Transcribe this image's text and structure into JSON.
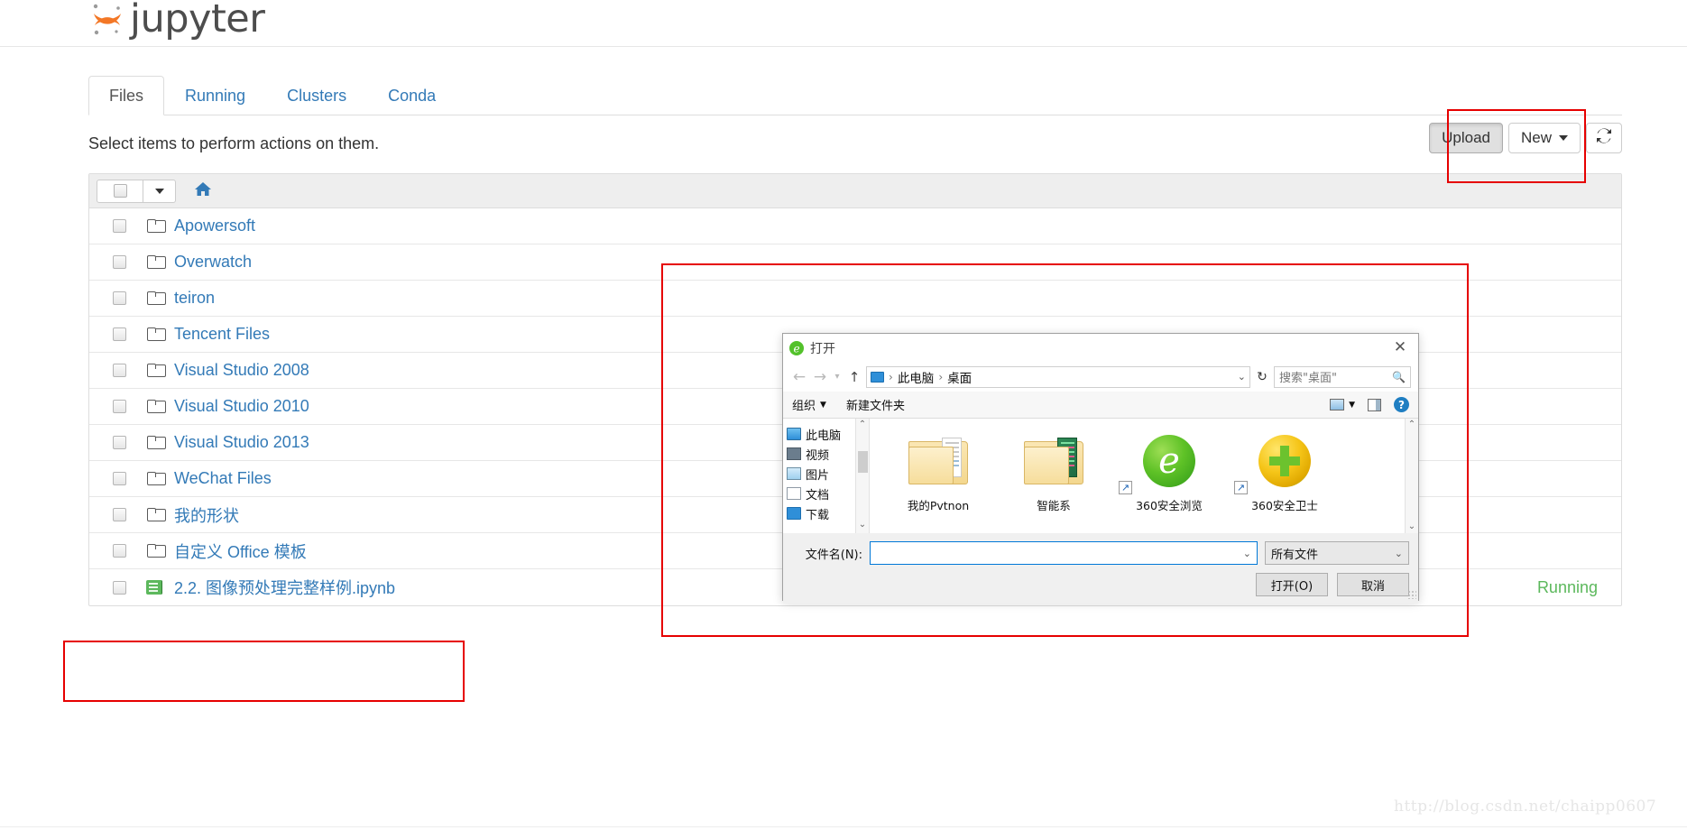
{
  "app": {
    "brand": "jupyter",
    "logo_icon": "jupyter-logo-icon"
  },
  "tabs": [
    {
      "label": "Files",
      "active": true
    },
    {
      "label": "Running",
      "active": false
    },
    {
      "label": "Clusters",
      "active": false
    },
    {
      "label": "Conda",
      "active": false
    }
  ],
  "notice": {
    "text": "Select items to perform actions on them."
  },
  "toolbar": {
    "upload_label": "Upload",
    "new_label": "New",
    "refresh_icon": "refresh-icon",
    "new_caret_icon": "caret-down-icon"
  },
  "list_header": {
    "select_all_icon": "checkbox-icon",
    "select_caret_icon": "caret-down-icon",
    "home_icon": "home-icon"
  },
  "files": [
    {
      "name": "Apowersoft",
      "icon": "folder-icon",
      "status": ""
    },
    {
      "name": "Overwatch",
      "icon": "folder-icon",
      "status": ""
    },
    {
      "name": "teiron",
      "icon": "folder-icon",
      "status": ""
    },
    {
      "name": "Tencent Files",
      "icon": "folder-icon",
      "status": ""
    },
    {
      "name": "Visual Studio 2008",
      "icon": "folder-icon",
      "status": ""
    },
    {
      "name": "Visual Studio 2010",
      "icon": "folder-icon",
      "status": ""
    },
    {
      "name": "Visual Studio 2013",
      "icon": "folder-icon",
      "status": ""
    },
    {
      "name": "WeChat Files",
      "icon": "folder-icon",
      "status": ""
    },
    {
      "name": "我的形状",
      "icon": "folder-icon",
      "status": ""
    },
    {
      "name": "自定义 Office 模板",
      "icon": "folder-icon",
      "status": ""
    },
    {
      "name": "2.2. 图像预处理完整样例.ipynb",
      "icon": "notebook-icon",
      "status": "Running"
    }
  ],
  "dialog": {
    "title": "打开",
    "title_icon": "ie-browser-icon",
    "close_icon": "close-icon",
    "nav": {
      "back_icon": "arrow-left-icon",
      "forward_icon": "arrow-right-icon",
      "history_icon": "caret-down-icon",
      "up_icon": "arrow-up-icon",
      "pc_icon": "this-pc-icon",
      "crumb1": "此电脑",
      "crumb2": "桌面",
      "separator": "›",
      "address_caret_icon": "caret-down-icon",
      "refresh_icon": "refresh-icon",
      "search_placeholder": "搜索\"桌面\"",
      "search_icon": "search-icon"
    },
    "toolbar": {
      "organize": "组织",
      "organize_caret_icon": "caret-down-icon",
      "new_folder": "新建文件夹",
      "view_icon": "view-options-icon",
      "view_caret_icon": "caret-down-icon",
      "preview_pane_icon": "preview-pane-icon",
      "help_icon": "help-icon",
      "help_glyph": "?"
    },
    "sidebar": [
      {
        "label": "此电脑",
        "icon": "this-pc-icon"
      },
      {
        "label": "视频",
        "icon": "videos-icon"
      },
      {
        "label": "图片",
        "icon": "pictures-icon"
      },
      {
        "label": "文档",
        "icon": "documents-icon"
      },
      {
        "label": "下载",
        "icon": "downloads-icon"
      }
    ],
    "sidebar_scroll": {
      "up_icon": "chevron-up-icon",
      "down_icon": "chevron-down-icon"
    },
    "items": [
      {
        "label": "我的Pvtnon",
        "icon": "folder-icon",
        "shortcut": false
      },
      {
        "label": "智能系",
        "icon": "folder-icon",
        "shortcut": false
      },
      {
        "label": "360安全浏览",
        "icon": "ie-browser-icon",
        "shortcut": true
      },
      {
        "label": "360安全卫士",
        "icon": "360-safeguard-icon",
        "shortcut": true
      }
    ],
    "items_scroll": {
      "up_icon": "chevron-up-icon",
      "down_icon": "chevron-down-icon"
    },
    "filename_label": "文件名(N):",
    "filename_value": "",
    "filename_caret_icon": "caret-down-icon",
    "filetype_value": "所有文件",
    "filetype_caret_icon": "caret-down-icon",
    "open_button": "打开(O)",
    "cancel_button": "取消",
    "resize_grip_icon": "resize-grip-icon"
  },
  "annotations": {
    "upload_box": "highlight-upload-button",
    "dialog_box": "highlight-open-dialog",
    "notebook_box": "highlight-notebook-row",
    "color": "#e60000"
  },
  "watermark": {
    "text": "http://blog.csdn.net/chaipp0607"
  }
}
